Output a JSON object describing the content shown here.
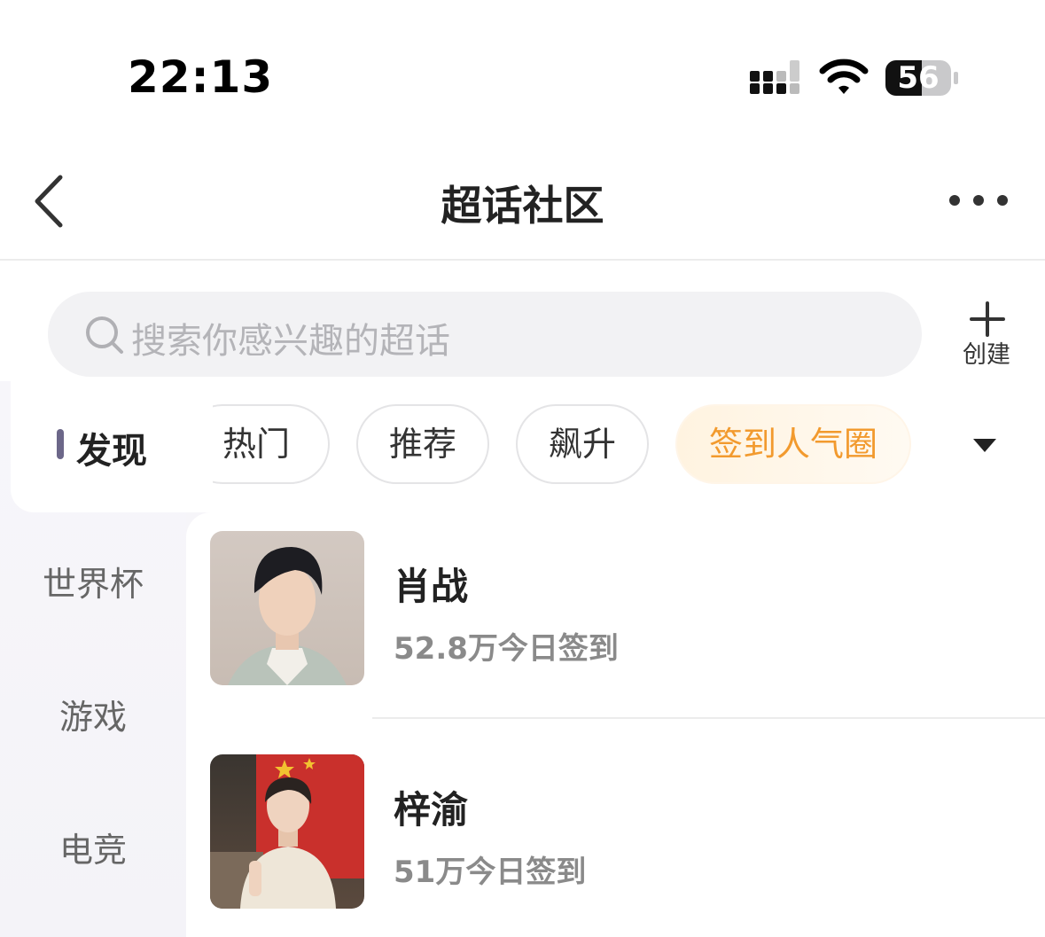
{
  "status_bar": {
    "time": "22:13",
    "battery": "56",
    "icons": [
      "cellular-signal-icon",
      "wifi-icon",
      "battery-icon"
    ]
  },
  "nav": {
    "title": "超话社区",
    "back_icon": "chevron-left-icon",
    "more_icon": "more-dots-icon"
  },
  "search": {
    "placeholder": "搜索你感兴趣的超话",
    "icon": "search-icon"
  },
  "create": {
    "label": "创建",
    "icon": "plus-icon"
  },
  "categories": [
    {
      "label": "发现",
      "active": true
    },
    {
      "label": "世界杯",
      "active": false
    },
    {
      "label": "游戏",
      "active": false
    },
    {
      "label": "电竞",
      "active": false
    }
  ],
  "chips": [
    {
      "label": "热门",
      "selected": false
    },
    {
      "label": "推荐",
      "selected": false
    },
    {
      "label": "飙升",
      "selected": false
    },
    {
      "label": "签到人气圈",
      "selected": true
    }
  ],
  "chips_expand_icon": "caret-down-icon",
  "list": [
    {
      "name": "肖战",
      "meta": "52.8万今日签到"
    },
    {
      "name": "梓渝",
      "meta": "51万今日签到"
    }
  ],
  "colors": {
    "accent": "#f29a2e",
    "active_bar": "#6c6789",
    "muted_text": "#8a8a8a"
  }
}
